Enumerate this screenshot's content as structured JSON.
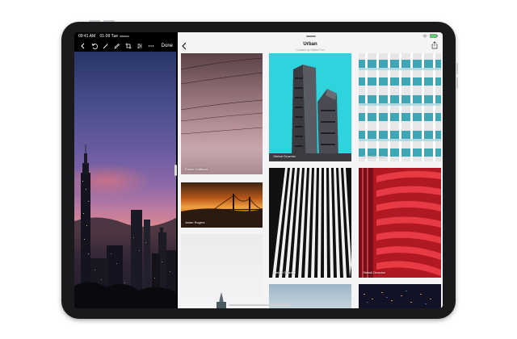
{
  "editor": {
    "status_time": "09:41 AM",
    "status_date": "01-09 Tue",
    "done_label": "Done",
    "tools": [
      "back-icon",
      "undo-icon",
      "magic-wand-icon",
      "pencil-icon",
      "crop-icon",
      "adjust-icon",
      "more-icon"
    ]
  },
  "gallery": {
    "title": "Urban",
    "subtitle": "Curated by Wiktor Peri",
    "photos": [
      {
        "author": "Parker Coffman"
      },
      {
        "author": "Oleksii Drozdov"
      },
      {
        "author": "Oleksii Drozdov"
      },
      {
        "author": "Julian Rogers"
      },
      {
        "author": "Oleksii Drozdov"
      },
      {
        "author": "Oleksii Drozdov"
      }
    ]
  },
  "colors": {
    "frame": "#1a1a1c",
    "gallery_bg": "#f4f4f6",
    "accent_cyan": "#2fd3dd",
    "accent_red": "#b01822"
  }
}
